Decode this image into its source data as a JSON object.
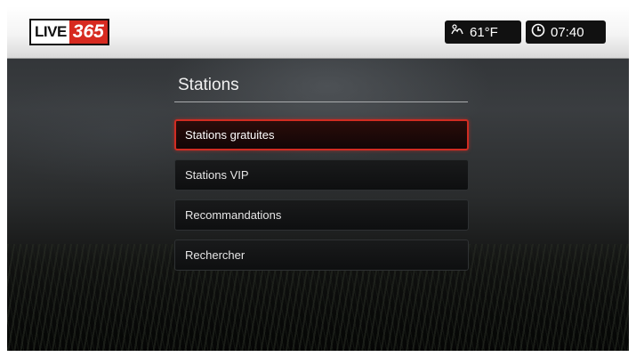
{
  "header": {
    "logo": {
      "text_live": "LIVE",
      "text_number": "365"
    },
    "weather": {
      "icon": "weather-icon",
      "temperature": "61°F"
    },
    "clock": {
      "icon": "clock-icon",
      "time": "07:40"
    }
  },
  "page": {
    "title": "Stations"
  },
  "menu": {
    "items": [
      {
        "label": "Stations gratuites",
        "selected": true
      },
      {
        "label": "Stations VIP",
        "selected": false
      },
      {
        "label": "Recommandations",
        "selected": false
      },
      {
        "label": "Rechercher",
        "selected": false
      }
    ]
  },
  "colors": {
    "accent_red": "#d02c22",
    "logo_red": "#d72a20",
    "topbar": "#f4f4f4",
    "menu_bg": "#111213",
    "text": "#e6e6e6"
  }
}
